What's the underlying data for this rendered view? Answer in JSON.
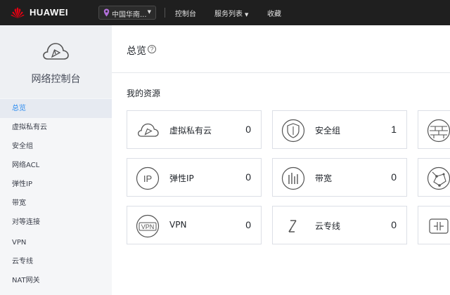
{
  "header": {
    "brand": "HUAWEI",
    "region": "中国华南...",
    "nav": [
      "控制台",
      "服务列表",
      "收藏"
    ]
  },
  "sidebar": {
    "title": "网络控制台",
    "items": [
      {
        "label": "总览",
        "active": true
      },
      {
        "label": "虚拟私有云"
      },
      {
        "label": "安全组"
      },
      {
        "label": "网络ACL"
      },
      {
        "label": "弹性IP"
      },
      {
        "label": "带宽"
      },
      {
        "label": "对等连接"
      },
      {
        "label": "VPN"
      },
      {
        "label": "云专线"
      },
      {
        "label": "NAT网关"
      }
    ]
  },
  "main": {
    "title": "总览",
    "section": "我的资源",
    "cards": [
      {
        "label": "虚拟私有云",
        "count": "0",
        "icon": "cloud-icon"
      },
      {
        "label": "安全组",
        "count": "1",
        "icon": "shield-icon"
      },
      {
        "label": "弹性IP",
        "count": "0",
        "icon": "elastic-ip-icon"
      },
      {
        "label": "带宽",
        "count": "0",
        "icon": "bandwidth-icon"
      },
      {
        "label": "VPN",
        "count": "0",
        "icon": "vpn-icon"
      },
      {
        "label": "云专线",
        "count": "0",
        "icon": "direct-connect-icon"
      }
    ]
  },
  "colors": {
    "topbar": "#1f1f1f",
    "accent": "#2d8cf0",
    "logo": "#e60012"
  }
}
